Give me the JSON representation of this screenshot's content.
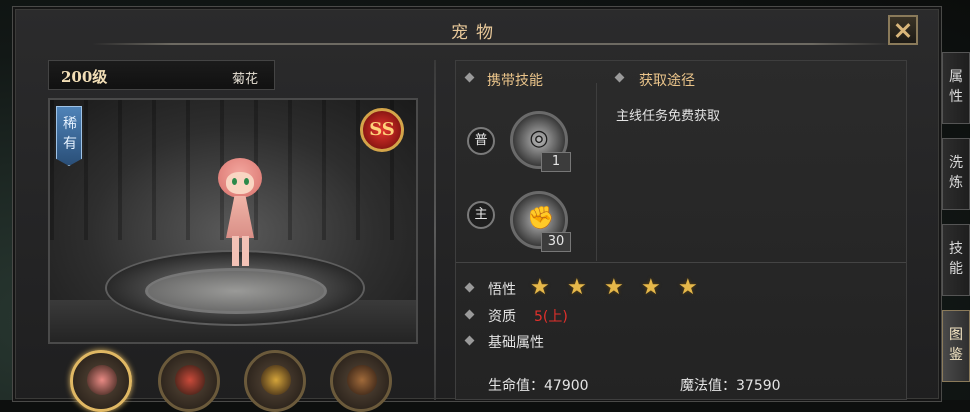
{
  "window": {
    "title": "宠物"
  },
  "pet": {
    "level": "200级",
    "name": "菊花",
    "rarity": "稀有",
    "grade_badge": "SS"
  },
  "thumbnails": [
    {
      "name": "pink-flower-pet",
      "selected": true,
      "color": "#e98a84"
    },
    {
      "name": "clown-pet",
      "selected": false,
      "color": "#c94a3a"
    },
    {
      "name": "pharaoh-pet",
      "selected": false,
      "color": "#d4a43a"
    },
    {
      "name": "witch-pet",
      "selected": false,
      "color": "#a06a3a"
    }
  ],
  "skills": {
    "header": "携带技能",
    "items": [
      {
        "tag": "普",
        "icon": "spiral-icon",
        "level": "1"
      },
      {
        "tag": "主",
        "icon": "fist-icon",
        "level": "30"
      }
    ]
  },
  "source": {
    "header": "获取途径",
    "text": "主线任务免费获取"
  },
  "attributes": {
    "aptitude_label": "悟性",
    "aptitude_stars": 5,
    "quality_label": "资质",
    "quality_value": "5(上)",
    "base_label": "基础属性",
    "hp": "生命值：47900",
    "mp": "魔法值：37590"
  },
  "tabs": [
    {
      "label": "属性",
      "active": false
    },
    {
      "label": "洗炼",
      "active": false
    },
    {
      "label": "技能",
      "active": false
    },
    {
      "label": "图鉴",
      "active": true
    }
  ],
  "colors": {
    "accent": "#eac48a",
    "grade_red": "#e2302b",
    "star": "#e6b84a"
  }
}
